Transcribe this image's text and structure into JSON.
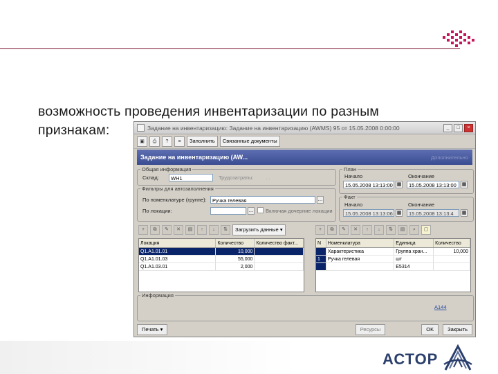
{
  "slide": {
    "headline_line1": "возможность проведения инвентаризации по разным",
    "headline_line2": "признакам:",
    "brand": "АСТОР",
    "brand_color": "#2b3f6c",
    "accent_color": "#c2185b"
  },
  "window": {
    "title": "Задание на инвентаризацию: Задание на инвентаризацию (AWMS) 95 от 15.05.2008 0:00:00",
    "controls": [
      "_",
      "□",
      "×"
    ],
    "toolbar": {
      "icons": [
        "save-icon",
        "print-icon",
        "help-icon",
        "structure-icon"
      ],
      "fill_label": "Заполнить",
      "related_docs_label": "Связанные документы"
    },
    "form_header": "Задание на инвентаризацию (AW...",
    "form_header_link": "Дополнительно",
    "general": {
      "legend": "Общая информация",
      "warehouse_label": "Склад:",
      "warehouse_value": "WH1",
      "labor_label": "Трудозатраты:",
      "labor_value": ". ."
    },
    "filters": {
      "legend": "Фильтры для автозаполнения",
      "nomenclature_label": "По номенклатуре (группе):",
      "nomenclature_value": "Ручка гелевая",
      "location_label": "По локации:",
      "location_value": "",
      "include_children_label": "Включая дочерние локации"
    },
    "plan": {
      "legend": "План",
      "start_label": "Начало",
      "start_value": "15.05.2008 13:13:00",
      "end_label": "Окончание",
      "end_value": "15.05.2008 13:13:00"
    },
    "fact": {
      "legend": "Факт",
      "start_label": "Начало",
      "start_value": "15.05.2008 13:13:06",
      "end_label": "Окончание",
      "end_value": "15.05.2008 13:13:4"
    },
    "load_data_label": "Загрузить данные",
    "left_grid": {
      "columns": [
        "Локация",
        "Количество",
        "Количество факт..."
      ],
      "rows": [
        [
          "Q1.A1.01.01",
          "10,000",
          ""
        ],
        [
          "Q1.A1.01.03",
          "55,000",
          ""
        ],
        [
          "Q1.A1.03.01",
          "2,000",
          ""
        ]
      ]
    },
    "right_grid": {
      "columns": [
        "N",
        "Номенклатура",
        "Единица",
        "Количество"
      ],
      "rows": [
        [
          "",
          "Характеристика",
          "Группа хран...",
          "10,000"
        ],
        [
          "1",
          "Ручка гелевая",
          "шт",
          ""
        ],
        [
          "",
          "",
          "E5314",
          ""
        ]
      ]
    },
    "info": {
      "legend": "Информация",
      "code": "A144"
    },
    "bottom": {
      "print_label": "Печать",
      "resources_label": "Ресурсы",
      "ok_label": "OK",
      "close_label": "Закрыть"
    }
  }
}
